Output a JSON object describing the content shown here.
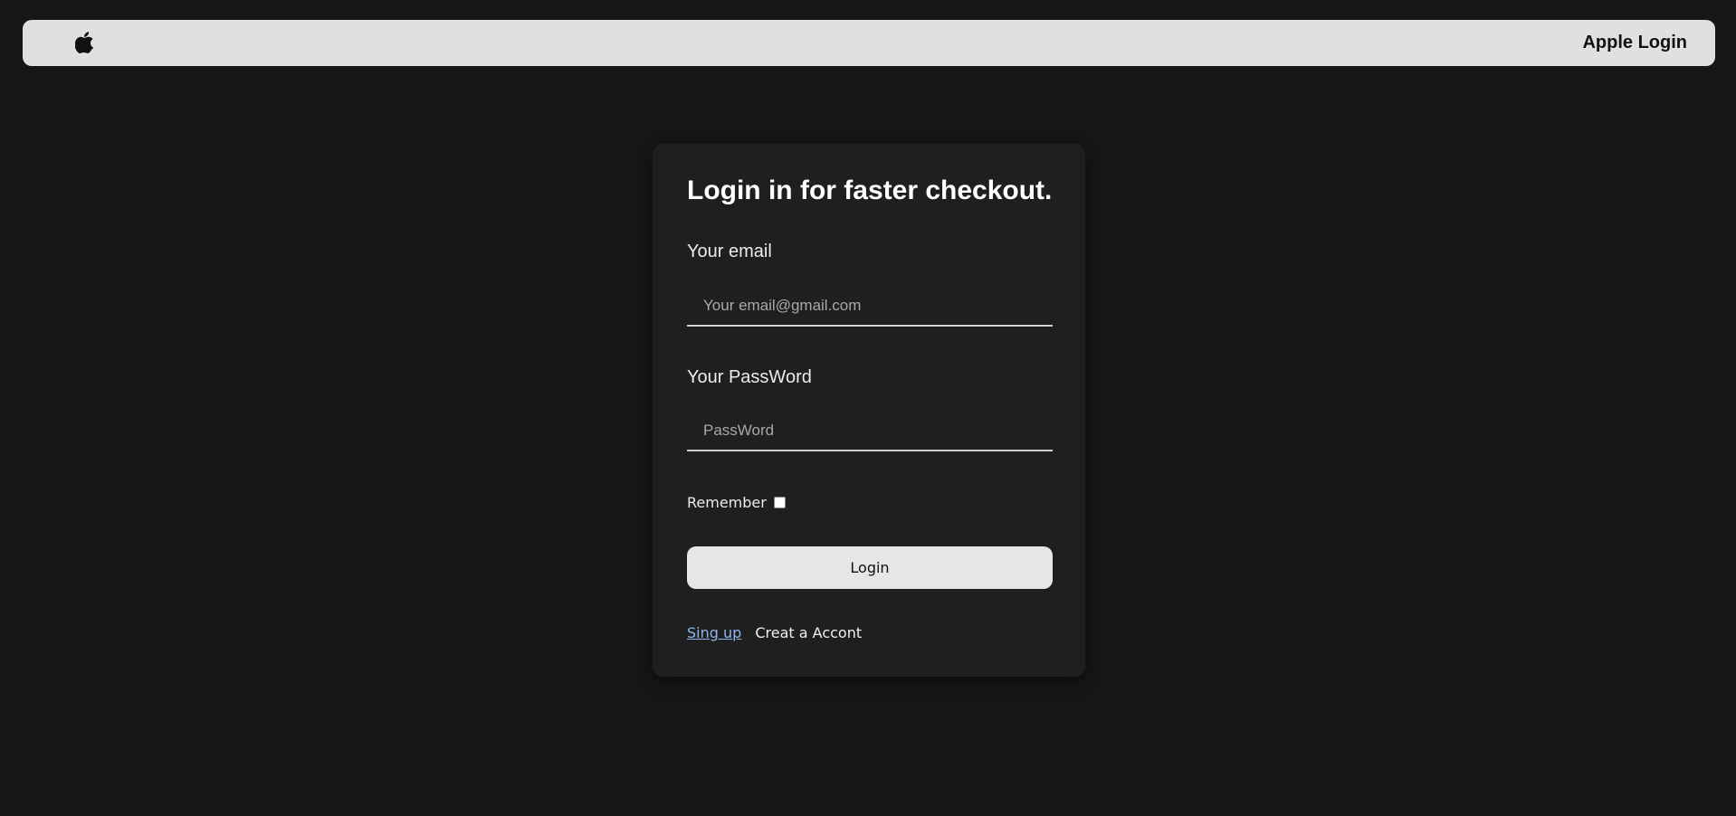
{
  "header": {
    "logo_icon": "apple-logo-icon",
    "title": "Apple Login"
  },
  "login_card": {
    "title": "Login in for faster checkout.",
    "email": {
      "label": "Your email",
      "value": "",
      "placeholder": "Your email@gmail.com"
    },
    "password": {
      "label": "Your PassWord",
      "value": "",
      "placeholder": "PassWord"
    },
    "remember": {
      "label": "Remember",
      "checked": false
    },
    "login_button": "Login",
    "signup_link": "Sing up",
    "create_account_text": "Creat a Accont"
  },
  "colors": {
    "page_background": "#161616",
    "header_background": "#e0e0e0",
    "card_background": "#1f1f1f",
    "button_background": "#e6e6e6",
    "link": "#8eb4f0"
  }
}
